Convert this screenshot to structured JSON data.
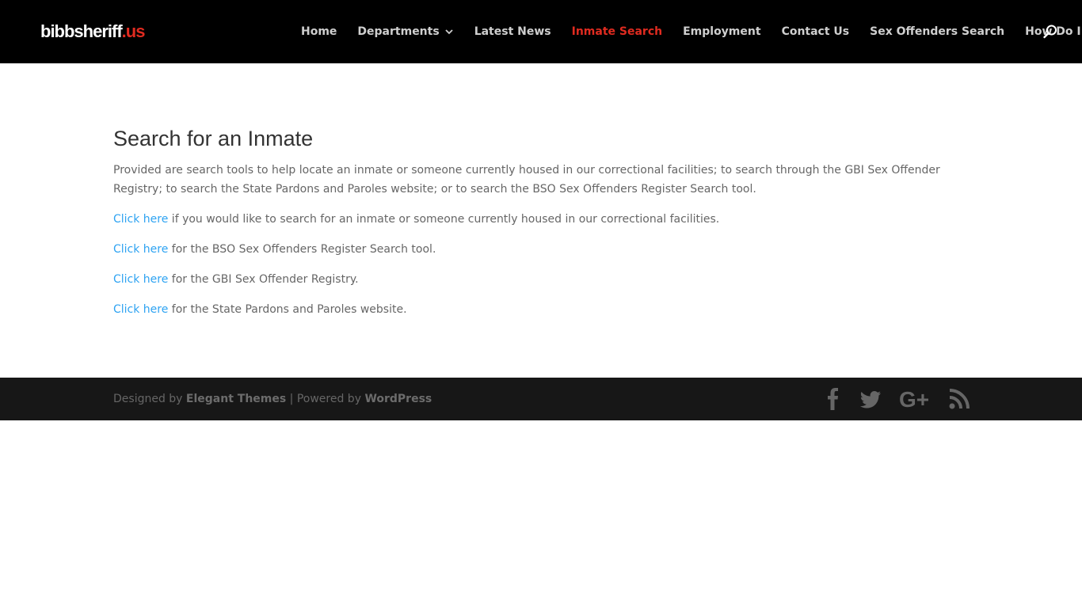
{
  "header": {
    "logo_main": "bibbsheriff",
    "logo_tld": ".us",
    "nav": [
      {
        "label": "Home",
        "has_dropdown": false,
        "active": false
      },
      {
        "label": "Departments",
        "has_dropdown": true,
        "active": false
      },
      {
        "label": "Latest News",
        "has_dropdown": false,
        "active": false
      },
      {
        "label": "Inmate Search",
        "has_dropdown": false,
        "active": true
      },
      {
        "label": "Employment",
        "has_dropdown": false,
        "active": false
      },
      {
        "label": "Contact Us",
        "has_dropdown": false,
        "active": false
      },
      {
        "label": "Sex Offenders Search",
        "has_dropdown": false,
        "active": false
      },
      {
        "label": "How Do I...",
        "has_dropdown": true,
        "active": false
      }
    ],
    "search_icon": "search-icon"
  },
  "main": {
    "title": "Search for an Inmate",
    "intro": "Provided are search tools to help locate an inmate or someone currently housed in our correctional facilities; to search through the GBI Sex Offender Registry; to search the State Pardons and Paroles website; or to search the BSO Sex Offenders Register Search tool.",
    "links": [
      {
        "link_text": "Click here",
        "rest": " if you would like to search for an inmate or someone currently housed in our correctional facilities."
      },
      {
        "link_text": "Click here",
        "rest": " for the BSO Sex Offenders Register Search tool."
      },
      {
        "link_text": "Click here",
        "rest": " for the GBI Sex Offender Registry."
      },
      {
        "link_text": "Click here",
        "rest": " for the State Pardons and Paroles website."
      }
    ]
  },
  "footer": {
    "designed_by": "Designed by ",
    "elegant_themes": "Elegant Themes",
    "separator": " | Powered by ",
    "wordpress": "WordPress",
    "social_icons": [
      "facebook-icon",
      "twitter-icon",
      "google-plus-icon",
      "rss-icon"
    ]
  },
  "colors": {
    "header_bg": "#000000",
    "footer_bg": "#171717",
    "accent_red": "#e02b20",
    "link_blue": "#2ea3f2",
    "body_text": "#666666",
    "title_text": "#333333"
  }
}
